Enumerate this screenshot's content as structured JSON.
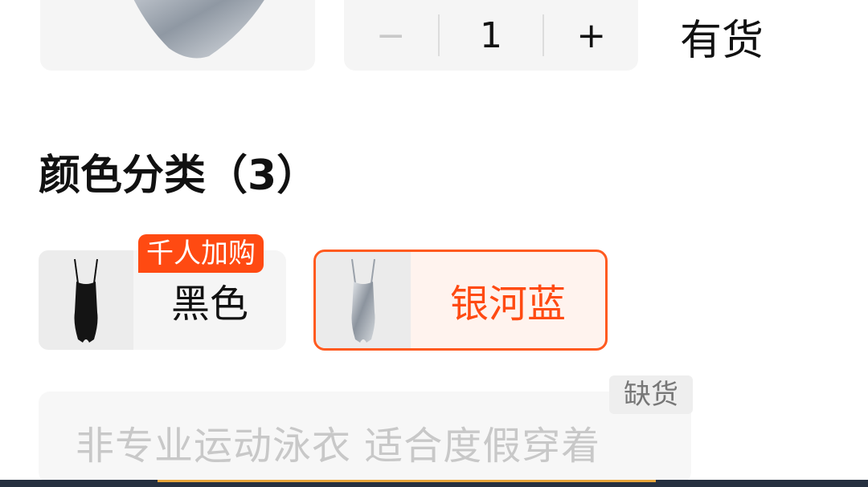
{
  "quantity": {
    "minus": "−",
    "value": "1",
    "plus": "+"
  },
  "stock_status": "有货",
  "color_section": {
    "title": "颜色分类（3）"
  },
  "options": [
    {
      "label": "黑色",
      "badge": "千人加购",
      "selected": false
    },
    {
      "label": "银河蓝",
      "selected": true
    }
  ],
  "unavailable_option": {
    "label": "非专业运动泳衣 适合度假穿着",
    "badge": "缺货"
  },
  "colors": {
    "accent": "#ff4a12",
    "selected_bg": "#fff3ee",
    "tile_bg": "#f5f5f5"
  }
}
